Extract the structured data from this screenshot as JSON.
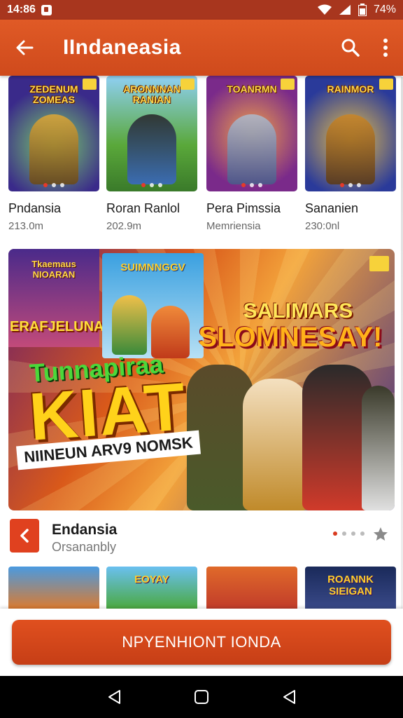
{
  "status_bar": {
    "time": "14:86",
    "battery": "74%"
  },
  "app_bar": {
    "title": "IIndaneasia"
  },
  "games": [
    {
      "thumb_text": "ZEDENUM ZOMEAS",
      "name": "Pndansia",
      "meta": "213.0m"
    },
    {
      "thumb_text": "ARONNNAN RANIAN",
      "name": "Roran Ranlol",
      "meta": "202.9m"
    },
    {
      "thumb_text": "TOANRMN",
      "name": "Pera Pimssia",
      "meta": "Memriensia"
    },
    {
      "thumb_text": "RAINMOR",
      "name": "Sananien",
      "meta": "230:0nl"
    }
  ],
  "banner": {
    "left_title": "Tkaemaus NIOARAN",
    "left_bottom": "ERAFJELUNAN",
    "mid_title": "SUIMNNGGV",
    "heading_a": "SALIMARS",
    "heading_b": "SLOMNESAY!",
    "sub": "Tunnapiraa",
    "big": "KIAT",
    "tag": "NIINEUN ARV9 NOMSK"
  },
  "featured": {
    "title": "Endansia",
    "subtitle": "Orsananbly"
  },
  "bottom_thumbs": [
    {
      "text": ""
    },
    {
      "text": "EOYAY"
    },
    {
      "text": ""
    },
    {
      "text": "ROANNK SIEIGAN"
    }
  ],
  "cta": {
    "label": "NPYENHIONT IONDA"
  },
  "colors": {
    "status_bar": "#a8361e",
    "app_bar": "#d9511f",
    "accent": "#e0411f",
    "nav_bar": "#000000"
  },
  "icons": {
    "back": "arrow-left-icon",
    "search": "search-icon",
    "more": "more-vert-icon",
    "star": "star-icon",
    "nav_back": "triangle-back-icon",
    "nav_home": "square-home-icon"
  }
}
